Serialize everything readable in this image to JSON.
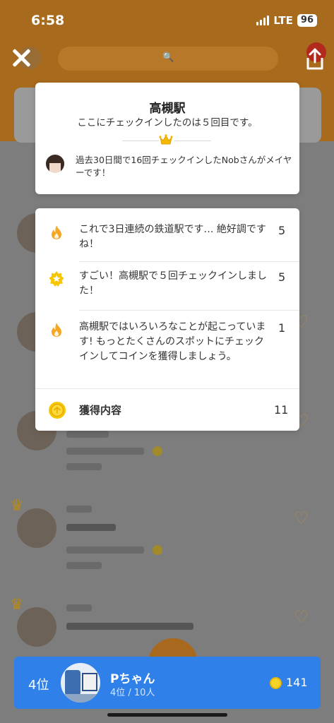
{
  "status_bar": {
    "time": "6:58",
    "network": "LTE",
    "battery": "96"
  },
  "background": {
    "search_glyph": "🔍",
    "rows": [
      {
        "crown": true
      },
      {
        "crown": false
      },
      {
        "crown": false
      },
      {
        "crown": true
      },
      {
        "crown": true
      }
    ]
  },
  "venue_card": {
    "title": "高槻駅",
    "checkin_count_text": "ここにチェックインしたのは５回目です。",
    "mayor_text": "過去30日間で16回チェックインしたNobさんがメイヤーです！"
  },
  "rewards": {
    "items": [
      {
        "icon": "flame-icon",
        "text": "これで3日連続の鉄道駅です… 絶好調ですね！",
        "count": "5"
      },
      {
        "icon": "star-badge-icon",
        "text": "すごい！高槻駅で５回チェックインしました！",
        "count": "5"
      },
      {
        "icon": "flame-icon",
        "text": "高槻駅ではいろいろなことが起こっています! もっとたくさんのスポットにチェックインしてコインを獲得しましょう。",
        "count": "1"
      }
    ],
    "total_label": "獲得内容",
    "total_count": "11"
  },
  "rank_bar": {
    "position": "4位",
    "name": "Pちゃん",
    "subtitle": "4位 / 10人",
    "coins": "141"
  },
  "colors": {
    "accent_orange": "#f5a623",
    "rank_blue": "#2f80e8",
    "coin_yellow": "#f6d327"
  }
}
